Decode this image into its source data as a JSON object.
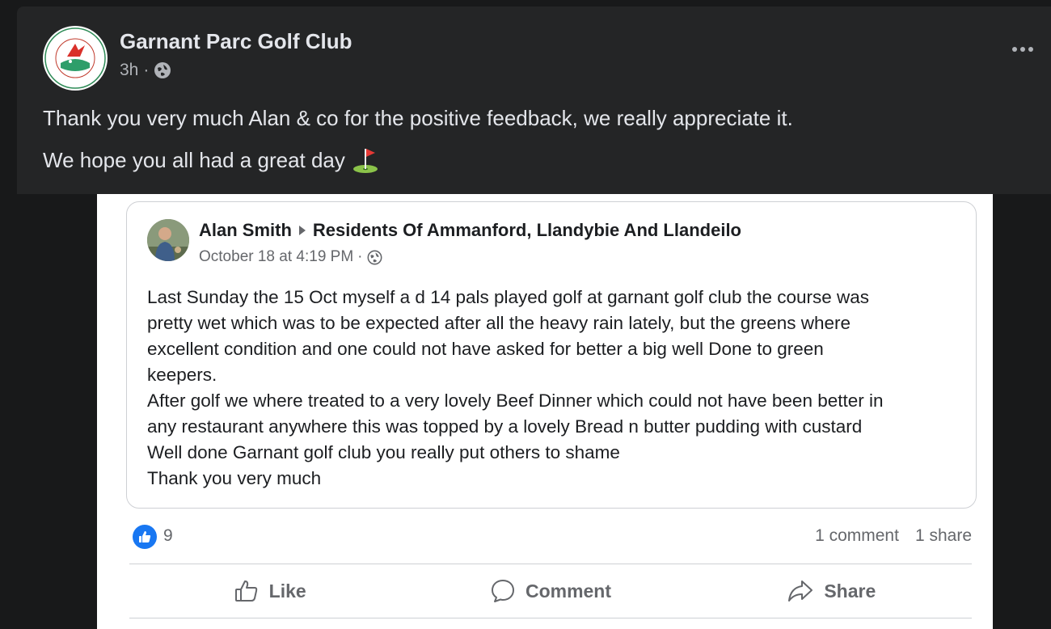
{
  "post": {
    "author": "Garnant Parc Golf Club",
    "time": "3h",
    "audience_icon": "globe-icon",
    "more_icon": "more-options-icon",
    "avatar_logo_text": "GARNANT PARK GOLF CLUB · 25 YEARS · 1997 2022",
    "message_line1": "Thank you very much Alan & co for the positive feedback, we really appreciate it.",
    "message_line2": "We hope you all had a great day",
    "message_emoji": "golf-flag-icon"
  },
  "shared": {
    "author": "Alan Smith",
    "group": "Residents Of Ammanford, Llandybie And Llandeilo",
    "time": "October 18 at 4:19 PM",
    "body_lines": [
      "Last Sunday the 15 Oct myself a d 14 pals played golf at garnant golf club the course was",
      "pretty wet which was to be  expected after all the heavy rain lately, but the greens where",
      "excellent condition  and one could not have asked for better a big well Done to green",
      "keepers.",
      "After golf we where treated to a very lovely Beef Dinner which could not have been better in",
      "any restaurant anywhere  this was topped by a lovely Bread n butter pudding with custard",
      "Well done Garnant golf club you really put others to shame",
      "Thank you very much"
    ]
  },
  "stats": {
    "likes": "9",
    "comments": "1 comment",
    "shares": "1 share"
  },
  "actions": {
    "like": "Like",
    "comment": "Comment",
    "share": "Share"
  },
  "colors": {
    "dark_bg": "#242526",
    "like_blue": "#1877f2",
    "text_light": "#e4e6eb",
    "text_muted": "#65676b"
  }
}
